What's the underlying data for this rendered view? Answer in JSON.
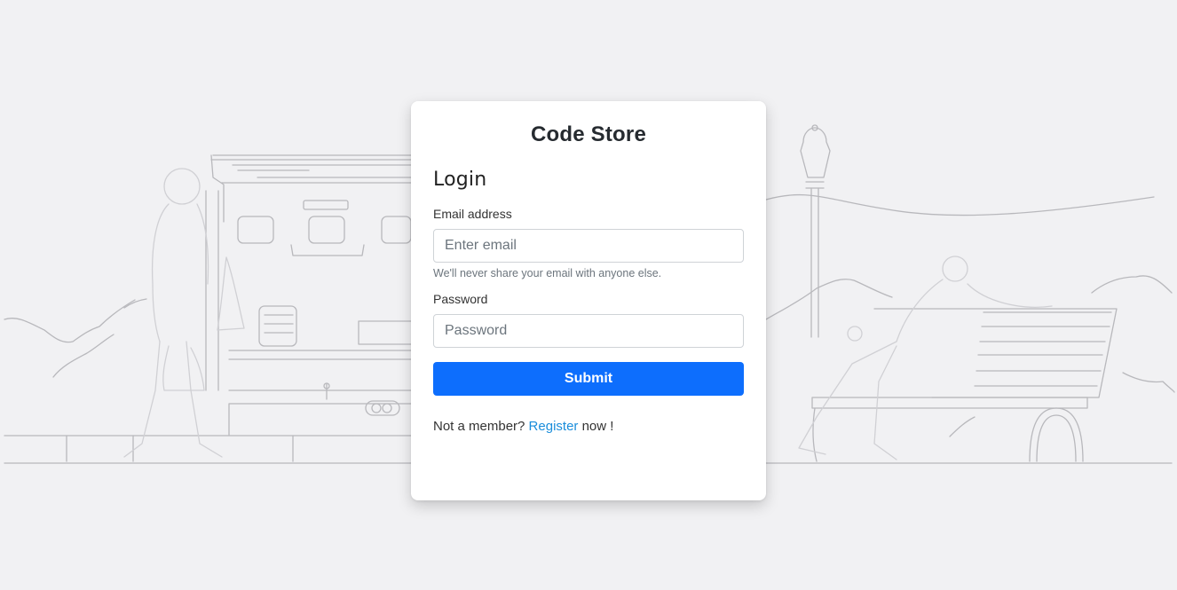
{
  "card": {
    "brand": "Code Store",
    "title": "Login"
  },
  "email": {
    "label": "Email address",
    "placeholder": "Enter email",
    "value": "",
    "hint": "We'll never share your email with anyone else."
  },
  "password": {
    "label": "Password",
    "placeholder": "Password",
    "value": ""
  },
  "submit": {
    "label": "Submit"
  },
  "register": {
    "prefix": "Not a member?",
    "link": "Register",
    "suffix": "now !"
  },
  "colors": {
    "background": "#f1f1f3",
    "card": "#ffffff",
    "primary": "#0d6efd",
    "link": "#1a8ddb",
    "sketch": "#b9b9bd"
  }
}
